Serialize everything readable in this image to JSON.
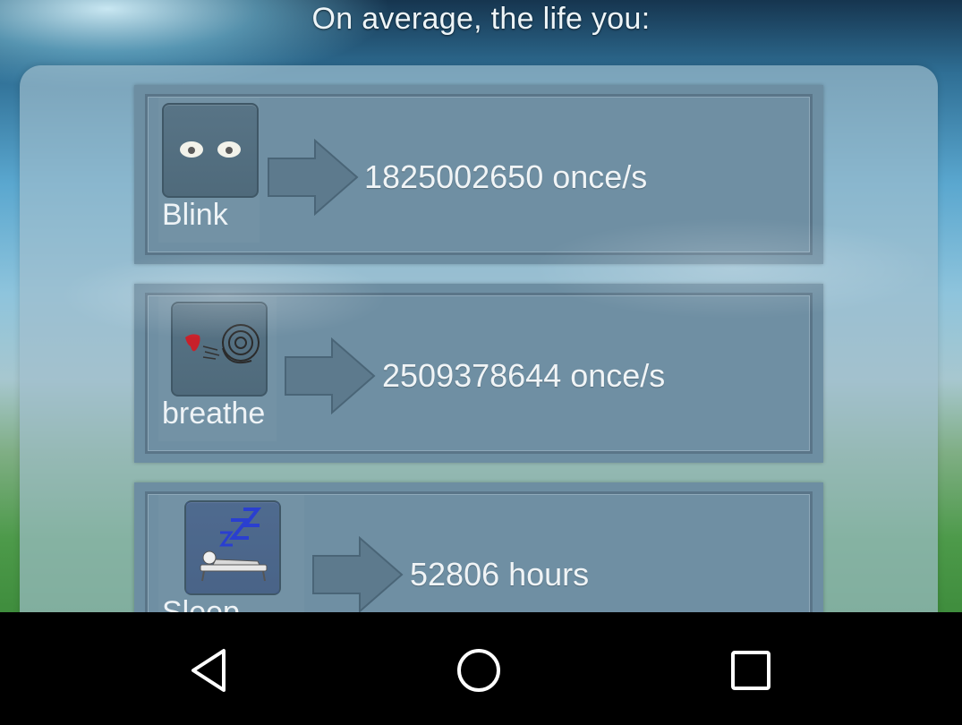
{
  "header": {
    "title": "On average, the life you:"
  },
  "items": [
    {
      "label": "Blink",
      "value": "1825002650 once/s",
      "icon": "eyes-icon"
    },
    {
      "label": "breathe",
      "value": "2509378644 once/s",
      "icon": "breath-icon"
    },
    {
      "label": "Sleep",
      "value": "52806 hours",
      "icon": "sleep-icon"
    }
  ],
  "navbar": {
    "back": "back-icon",
    "home": "home-icon",
    "recents": "recents-icon"
  }
}
